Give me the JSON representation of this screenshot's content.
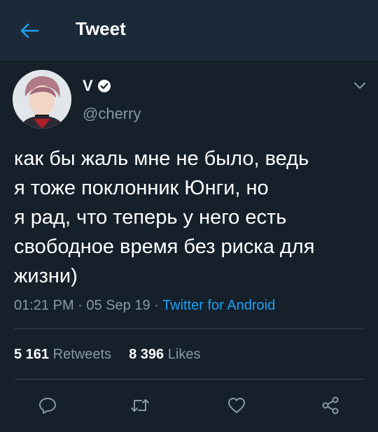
{
  "header": {
    "title": "Tweet",
    "back_icon": "arrow-left-icon"
  },
  "tweet": {
    "author_name": "V",
    "verified_icon": "verified-badge-icon",
    "handle": "@cherry",
    "text_lines": [
      "как бы жаль мне не было, ведь",
      "я тоже поклонник Юнги, но",
      "я рад, что теперь у него есть",
      "свободное время без риска для",
      "жизни)"
    ],
    "time": "01:21 PM",
    "date": "05 Sep 19",
    "separator": " · ",
    "source": "Twitter for Android",
    "stats": {
      "retweets_count": "5 161",
      "retweets_label": "Retweets",
      "likes_count": "8 396",
      "likes_label": "Likes"
    }
  },
  "actions": [
    "reply-icon",
    "retweet-icon",
    "like-icon",
    "share-icon"
  ],
  "colors": {
    "background": "#15202b",
    "topbar": "#1c2938",
    "accent": "#1da1f2",
    "muted": "#8899a6",
    "divider": "#38444d"
  }
}
